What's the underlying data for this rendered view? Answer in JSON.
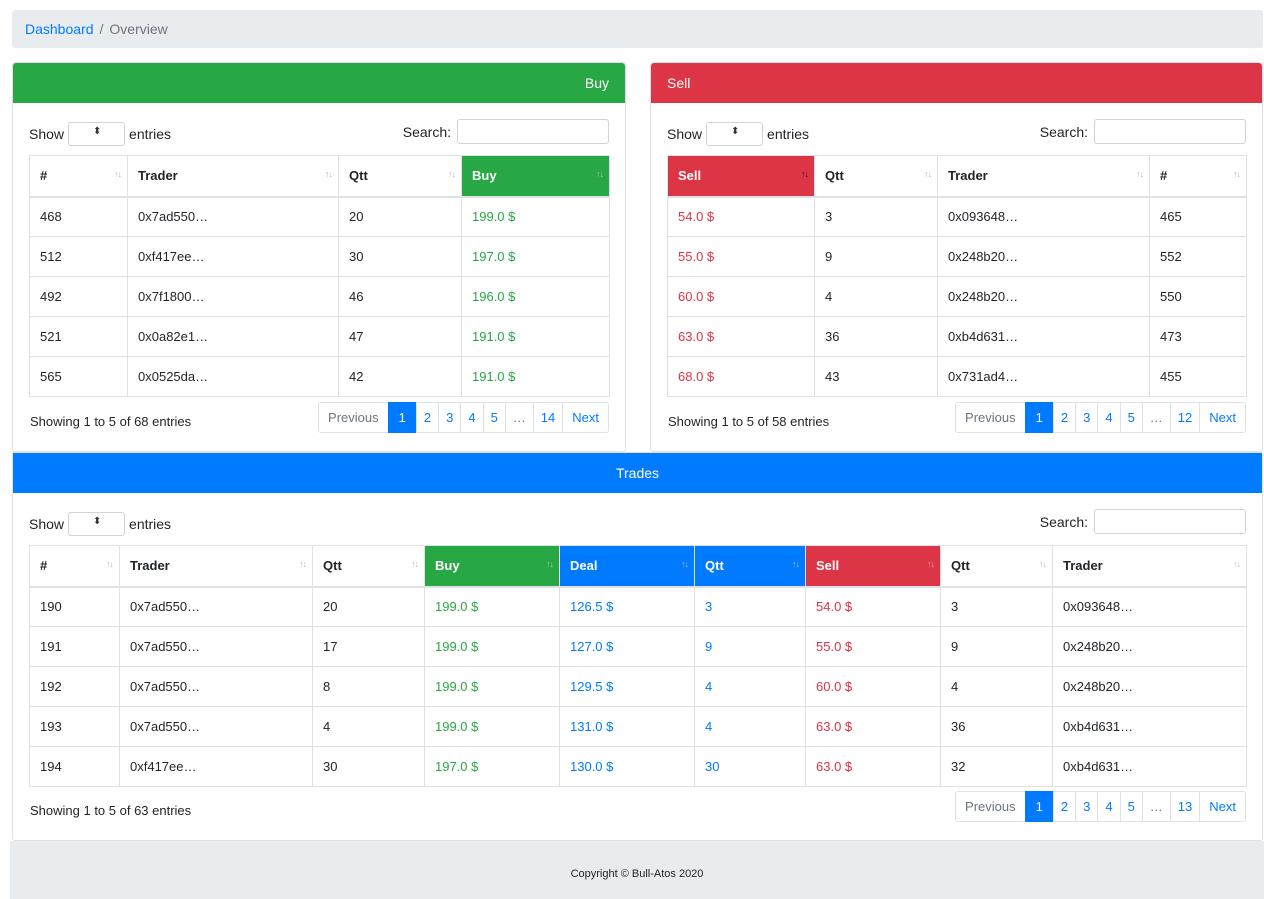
{
  "breadcrumb": {
    "home": "Dashboard",
    "separator": "/",
    "current": "Overview"
  },
  "common": {
    "show": "Show",
    "entries": "entries",
    "search": "Search:",
    "previous": "Previous",
    "next": "Next",
    "ellipsis": "…",
    "sort_glyph": "↑↓"
  },
  "buy": {
    "title": "Buy",
    "columns": [
      "#",
      "Trader",
      "Qtt",
      "Buy"
    ],
    "rows": [
      [
        "468",
        "0x7ad550…",
        "20",
        "199.0 $"
      ],
      [
        "512",
        "0xf417ee…",
        "30",
        "197.0 $"
      ],
      [
        "492",
        "0x7f1800…",
        "46",
        "196.0 $"
      ],
      [
        "521",
        "0x0a82e1…",
        "47",
        "191.0 $"
      ],
      [
        "565",
        "0x0525da…",
        "42",
        "191.0 $"
      ]
    ],
    "info": "Showing 1 to 5 of 68 entries",
    "pages": [
      "1",
      "2",
      "3",
      "4",
      "5"
    ],
    "last_page": "14"
  },
  "sell": {
    "title": "Sell",
    "columns": [
      "Sell",
      "Qtt",
      "Trader",
      "#"
    ],
    "rows": [
      [
        "54.0 $",
        "3",
        "0x093648…",
        "465"
      ],
      [
        "55.0 $",
        "9",
        "0x248b20…",
        "552"
      ],
      [
        "60.0 $",
        "4",
        "0x248b20…",
        "550"
      ],
      [
        "63.0 $",
        "36",
        "0xb4d631…",
        "473"
      ],
      [
        "68.0 $",
        "43",
        "0x731ad4…",
        "455"
      ]
    ],
    "info": "Showing 1 to 5 of 58 entries",
    "pages": [
      "1",
      "2",
      "3",
      "4",
      "5"
    ],
    "last_page": "12"
  },
  "trades": {
    "title": "Trades",
    "columns": [
      "#",
      "Trader",
      "Qtt",
      "Buy",
      "Deal",
      "Qtt",
      "Sell",
      "Qtt",
      "Trader"
    ],
    "rows": [
      [
        "190",
        "0x7ad550…",
        "20",
        "199.0 $",
        "126.5 $",
        "3",
        "54.0 $",
        "3",
        "0x093648…"
      ],
      [
        "191",
        "0x7ad550…",
        "17",
        "199.0 $",
        "127.0 $",
        "9",
        "55.0 $",
        "9",
        "0x248b20…"
      ],
      [
        "192",
        "0x7ad550…",
        "8",
        "199.0 $",
        "129.5 $",
        "4",
        "60.0 $",
        "4",
        "0x248b20…"
      ],
      [
        "193",
        "0x7ad550…",
        "4",
        "199.0 $",
        "131.0 $",
        "4",
        "63.0 $",
        "36",
        "0xb4d631…"
      ],
      [
        "194",
        "0xf417ee…",
        "30",
        "197.0 $",
        "130.0 $",
        "30",
        "63.0 $",
        "32",
        "0xb4d631…"
      ]
    ],
    "info": "Showing 1 to 5 of 63 entries",
    "pages": [
      "1",
      "2",
      "3",
      "4",
      "5"
    ],
    "last_page": "13"
  },
  "footer": {
    "text": "Copyright © Bull-Atos 2020"
  },
  "colors": {
    "buy": "#28a745",
    "sell": "#dc3545",
    "deal": "#007bff",
    "breadcrumb_bg": "#e9ecef"
  }
}
